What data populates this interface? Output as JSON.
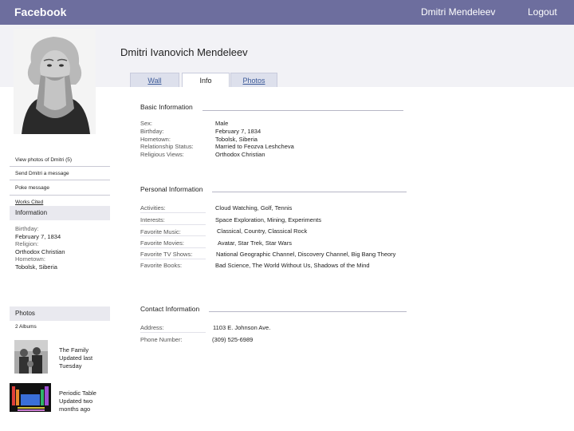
{
  "topbar": {
    "brand": "Facebook",
    "user_name": "Dmitri Mendeleev",
    "logout": "Logout"
  },
  "profile": {
    "full_name": "Dmitri Ivanovich Mendeleev"
  },
  "tabs": {
    "wall": "Wall",
    "info": "Info",
    "photos": "Photos"
  },
  "left": {
    "view_photos": "View photos of Dmitri (5)",
    "send_message": "Send Dmitri a message",
    "poke": "Poke message",
    "works_cited": "Works Cited",
    "info_heading": "Information",
    "info_lines": [
      {
        "label": "Birthday:",
        "value": "February 7, 1834"
      },
      {
        "label": "Religion:",
        "value": "Orthodox Christian"
      },
      {
        "label": "Hometown:",
        "value": "Tobolsk, Siberia"
      }
    ],
    "photos_heading": "Photos",
    "albums_count": "2 Albums",
    "albums": [
      {
        "title": "The Family",
        "updated": "Updated last Tuesday"
      },
      {
        "title": "Periodic Table",
        "updated": "Updated two months ago"
      }
    ]
  },
  "basic": {
    "title": "Basic Information",
    "labels": [
      "Sex:",
      "Birthday:",
      "Hometown:",
      "Relationship Status:",
      "Religious Views:"
    ],
    "values": [
      "Male",
      "February 7, 1834",
      "Tobolsk, Siberia",
      "Married to Feozva Leshcheva",
      "Orthodox Christian"
    ]
  },
  "personal": {
    "title": "Personal Information",
    "rows": [
      {
        "label": "Activities:",
        "value": "Cloud Watching, Golf, Tennis"
      },
      {
        "label": "Interests:",
        "value": "Space Exploration, Mining, Experiments"
      },
      {
        "label": "Favorite Music:",
        "value": "Classical, Country, Classical Rock"
      },
      {
        "label": "Favorite Movies:",
        "value": "Avatar, Star Trek, Star Wars"
      },
      {
        "label": "Favorite TV Shows:",
        "value": "National Geographic Channel, Discovery Channel, Big Bang Theory"
      },
      {
        "label": "Favorite Books:",
        "value": "Bad Science, The World Without Us, Shadows of the Mind"
      }
    ]
  },
  "contact": {
    "title": "Contact Information",
    "rows": [
      {
        "label": "Address:",
        "value": "1103 E. Johnson Ave."
      },
      {
        "label": "Phone Number:",
        "value": "(309) 525-6989"
      }
    ]
  },
  "colors": {
    "topbar": "#6d6e9e",
    "link": "#3b5998",
    "band": "#f2f2f6"
  }
}
